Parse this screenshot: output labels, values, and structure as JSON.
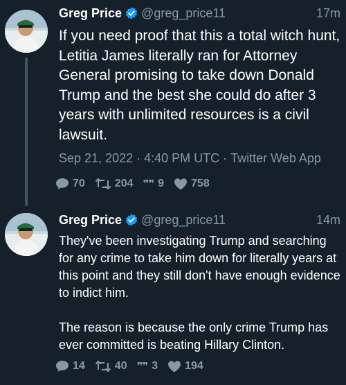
{
  "colors": {
    "background": "#15202b",
    "text": "#ffffff",
    "muted": "#8899a6",
    "verified": "#1d9bf0"
  },
  "tweets": [
    {
      "author": {
        "name": "Greg Price",
        "handle": "@greg_price11",
        "verified": true
      },
      "time": "17m",
      "text": "If you need proof that this a total witch hunt, Letitia James literally ran for Attorney General promising to take down Donald Trump and the best she could do after 3 years with unlimited resources is a civil lawsuit.",
      "meta": {
        "date": "Sep 21, 2022",
        "clock": "4:40 PM UTC",
        "client": "Twitter Web App",
        "separator": "·"
      },
      "stats": {
        "replies": "70",
        "retweets": "204",
        "quotes": "9",
        "likes": "758"
      }
    },
    {
      "author": {
        "name": "Greg Price",
        "handle": "@greg_price11",
        "verified": true
      },
      "time": "14m",
      "text": "They've been investigating Trump and searching for any crime to take him down for literally years at this point and they still don't have enough evidence to indict him.\n\nThe reason is because the only crime Trump has ever committed is beating Hillary Clinton.",
      "stats": {
        "replies": "14",
        "retweets": "40",
        "quotes": "3",
        "likes": "194"
      }
    }
  ]
}
